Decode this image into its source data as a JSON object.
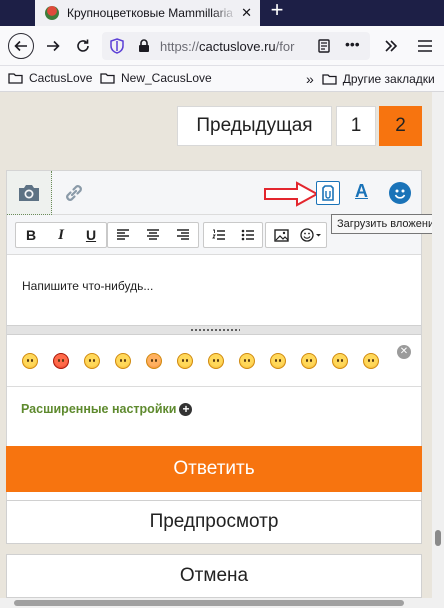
{
  "browser": {
    "tab_title": "Крупноцветковые Mammillaria",
    "tab_close": "✕",
    "new_tab": "+",
    "url_prefix": "https://",
    "url_host": "cactuslove.ru",
    "url_rest": "/for",
    "bookmarks": [
      {
        "label": "CactusLove"
      },
      {
        "label": "New_CacusLove"
      }
    ],
    "other_bookmarks": "Другие закладки"
  },
  "pagination": {
    "prev_label": "Предыдущая",
    "page1": "1",
    "page2": "2"
  },
  "editor": {
    "placeholder": "Напишите что-нибудь...",
    "tooltip": "Загрузить вложения",
    "advanced_settings": "Расширенные настройки",
    "accent_color": "#f7740f",
    "link_color": "#5e8a2e"
  },
  "actions": {
    "submit": "Ответить",
    "preview": "Предпросмотр",
    "cancel": "Отмена"
  }
}
